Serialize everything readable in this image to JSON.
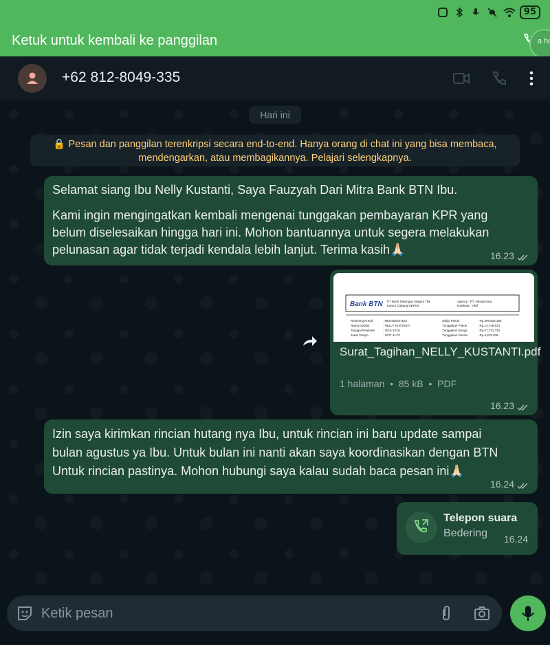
{
  "status_bar": {
    "battery": "95"
  },
  "call_banner": {
    "text": "Ketuk untuk kembali ke panggilan",
    "hover_text": "a ho"
  },
  "header": {
    "contact": "+62 812-8049-335"
  },
  "chat": {
    "date_label": "Hari ini",
    "encryption_notice_line1": "🔒 Pesan dan panggilan terenkripsi secara end-to-end. Hanya orang di chat ini yang bisa membaca,",
    "encryption_notice_line2": "mendengarkan, atau membagikannya. Pelajari selengkapnya.",
    "messages": [
      {
        "line1": "Selamat siang Ibu Nelly Kustanti, Saya Fauzyah Dari Mitra Bank BTN Ibu.",
        "line2": "Kami ingin mengingatkan kembali mengenai tunggakan pembayaran KPR yang",
        "line3": "belum diselesaikan hingga hari ini. Mohon bantuannya untuk segera melakukan",
        "line4": "pelunasan agar tidak terjadi kendala lebih lanjut. Terima kasih🙏🏻",
        "time": "16.23"
      },
      {
        "doc_name": "Surat_Tagihan_NELLY_KUSTANTI.pdf",
        "doc_pages": "1 halaman",
        "doc_size": "85 kB",
        "doc_type": "PDF",
        "preview": {
          "bank_logo": "Bank BTN",
          "bank_name": "PT Bank Tabungan Negara Tbk",
          "branch": "Kantor Cabang DEPOK",
          "agency": "Agency      : PT. Nesaarrtara",
          "kolek": "Kolektasi    : Aktif",
          "rows": [
            [
              "Rekening Kredit",
              ": 6801050037162",
              "Saldo Pokok",
              ": Rp.396,622,366"
            ],
            [
              "Nama Debitur",
              ": NELLY KUSTANTI",
              "Tunggakan Pokok",
              ": Rp.14,746,634"
            ],
            [
              "Tanggal Realisasi",
              ": 2016-10-31",
              "Tunggakan Bunga",
              ": Rp.67,731,720"
            ],
            [
              "Jatuh Tempo",
              ": 2037-11-07",
              "Tunggakan Denda",
              ": Rp.6,879,036"
            ]
          ]
        },
        "time": "16.23"
      },
      {
        "line1": "Izin saya kirimkan rincian hutang nya Ibu, untuk rincian ini baru update sampai",
        "line2": "bulan agustus ya Ibu. Untuk bulan ini nanti akan saya koordinasikan dengan BTN",
        "line3": "Untuk rincian pastinya. Mohon hubungi saya kalau sudah baca pesan ini🙏🏻",
        "time": "16.24"
      },
      {
        "call_title": "Telepon suara",
        "call_status": "Bedering",
        "time": "16.24"
      }
    ]
  },
  "composer": {
    "placeholder": "Ketik pesan"
  },
  "colors": {
    "accent": "#51b75c",
    "bubble": "#1f4a35",
    "background": "#0b141a"
  }
}
